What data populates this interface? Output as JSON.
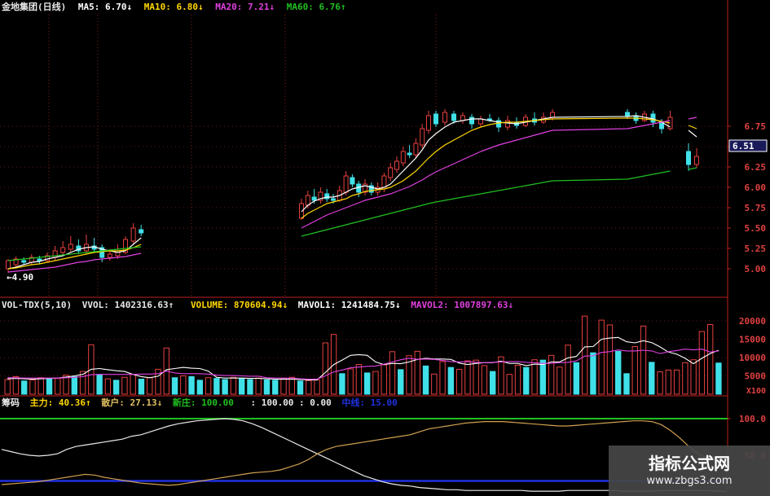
{
  "header_main": {
    "title": "金地集团(日线)",
    "ma5": "MA5: 6.70↓",
    "ma10": "MA10: 6.80↓",
    "ma20": "MA20: 7.21↓",
    "ma60": "MA60: 6.76↑"
  },
  "header_vol": {
    "name": "VOL-TDX(5,10)",
    "vvol": "VVOL: 1402316.63↑",
    "volume": "VOLUME: 870604.94↓",
    "mavol1": "MAVOL1: 1241484.75↓",
    "mavol2": "MAVOL2: 1007897.63↓"
  },
  "header_chip": {
    "name": "筹码",
    "zhuli": "主力: 40.36↑",
    "sanhu": "散户: 27.13↓",
    "xinzhuang": "新庄: 100.00",
    "other": ": 100.00 : 0.00",
    "zhongxian": "中线: 15.00"
  },
  "price_labels": {
    "current": "6.51",
    "low_mark": "4.90"
  },
  "colors": {
    "up": "#e84040",
    "down": "#40e0e8",
    "ma5": "#ffffff",
    "ma10": "#ffd700",
    "ma20": "#e040e0",
    "ma60": "#20c020",
    "axis": "#c02020",
    "ytext": "#e04040"
  },
  "watermark": {
    "title": "指标公式网",
    "url": "www.zbgs3.com"
  },
  "chart_data": [
    {
      "type": "candlestick",
      "title": "金地集团(日线)",
      "y_ticks": [
        5.0,
        5.25,
        5.5,
        5.75,
        6.0,
        6.25,
        6.5,
        6.75
      ],
      "ylim": [
        4.85,
        6.95
      ],
      "current_price": 6.51,
      "low_label": 4.9,
      "candles": [
        [
          5.0,
          5.1,
          4.95,
          5.12
        ],
        [
          5.05,
          5.12,
          5.02,
          5.15
        ],
        [
          5.1,
          5.08,
          5.05,
          5.14
        ],
        [
          5.08,
          5.14,
          5.04,
          5.18
        ],
        [
          5.12,
          5.1,
          5.06,
          5.16
        ],
        [
          5.1,
          5.16,
          5.08,
          5.2
        ],
        [
          5.14,
          5.22,
          5.1,
          5.28
        ],
        [
          5.2,
          5.26,
          5.16,
          5.34
        ],
        [
          5.24,
          5.3,
          5.2,
          5.4
        ],
        [
          5.28,
          5.22,
          5.18,
          5.36
        ],
        [
          5.22,
          5.3,
          5.18,
          5.42
        ],
        [
          5.28,
          5.24,
          5.2,
          5.38
        ],
        [
          5.26,
          5.14,
          5.08,
          5.3
        ],
        [
          5.14,
          5.18,
          5.1,
          5.24
        ],
        [
          5.16,
          5.22,
          5.12,
          5.3
        ],
        [
          5.2,
          5.36,
          5.18,
          5.4
        ],
        [
          5.34,
          5.5,
          5.3,
          5.56
        ],
        [
          5.48,
          5.44,
          5.4,
          5.54
        ],
        [
          5.62,
          5.8,
          5.6,
          5.86
        ],
        [
          5.78,
          5.9,
          5.74,
          5.96
        ],
        [
          5.88,
          5.84,
          5.8,
          5.98
        ],
        [
          5.84,
          5.94,
          5.8,
          6.0
        ],
        [
          5.92,
          5.86,
          5.82,
          5.98
        ],
        [
          5.86,
          5.84,
          5.8,
          5.92
        ],
        [
          5.84,
          5.96,
          5.82,
          6.02
        ],
        [
          5.94,
          6.14,
          5.9,
          6.2
        ],
        [
          6.12,
          6.04,
          6.0,
          6.16
        ],
        [
          6.04,
          5.94,
          5.88,
          6.08
        ],
        [
          5.94,
          6.04,
          5.9,
          6.1
        ],
        [
          6.02,
          5.94,
          5.9,
          6.06
        ],
        [
          5.94,
          6.0,
          5.9,
          6.06
        ],
        [
          5.98,
          6.14,
          5.94,
          6.18
        ],
        [
          6.12,
          6.24,
          6.08,
          6.3
        ],
        [
          6.22,
          6.32,
          6.18,
          6.38
        ],
        [
          6.3,
          6.44,
          6.26,
          6.5
        ],
        [
          6.42,
          6.4,
          6.36,
          6.52
        ],
        [
          6.4,
          6.54,
          6.36,
          6.6
        ],
        [
          6.52,
          6.72,
          6.48,
          6.78
        ],
        [
          6.7,
          6.88,
          6.66,
          6.94
        ],
        [
          6.9,
          6.78,
          6.74,
          6.94
        ],
        [
          6.8,
          6.92,
          6.76,
          6.96
        ],
        [
          6.9,
          6.82,
          6.78,
          6.94
        ],
        [
          6.82,
          6.88,
          6.78,
          6.92
        ],
        [
          6.86,
          6.78,
          6.72,
          6.9
        ],
        [
          6.78,
          6.84,
          6.74,
          6.88
        ],
        [
          6.84,
          6.82,
          6.8,
          6.9
        ],
        [
          6.82,
          6.74,
          6.68,
          6.86
        ],
        [
          6.74,
          6.82,
          6.7,
          6.88
        ],
        [
          6.8,
          6.76,
          6.72,
          6.86
        ],
        [
          6.76,
          6.86,
          6.74,
          6.9
        ],
        [
          6.84,
          6.8,
          6.76,
          6.92
        ],
        [
          6.8,
          6.86,
          6.78,
          6.92
        ],
        [
          6.86,
          6.92,
          6.82,
          6.96
        ],
        [
          6.92,
          6.88,
          6.84,
          6.96
        ],
        [
          6.88,
          6.82,
          6.78,
          6.92
        ],
        [
          6.82,
          6.9,
          6.8,
          6.94
        ],
        [
          6.9,
          6.8,
          6.74,
          6.94
        ],
        [
          6.8,
          6.72,
          6.66,
          6.84
        ],
        [
          6.72,
          6.86,
          6.7,
          6.94
        ],
        [
          6.44,
          6.28,
          6.2,
          6.54
        ],
        [
          6.28,
          6.38,
          6.24,
          6.48
        ]
      ],
      "series": [
        {
          "name": "MA5",
          "values": [
            5.0,
            5.02,
            5.05,
            5.08,
            5.09,
            5.12,
            5.14,
            5.16,
            5.2,
            5.24,
            5.26,
            5.27,
            5.24,
            5.22,
            5.2,
            5.22,
            5.3,
            5.38,
            5.7,
            5.78,
            5.83,
            5.86,
            5.88,
            5.88,
            5.9,
            5.94,
            5.98,
            6.0,
            6.02,
            6.0,
            5.98,
            6.0,
            6.04,
            6.12,
            6.2,
            6.28,
            6.36,
            6.46,
            6.58,
            6.66,
            6.74,
            6.8,
            6.82,
            6.84,
            6.84,
            6.82,
            6.8,
            6.79,
            6.78,
            6.8,
            6.82,
            6.84,
            6.86,
            6.87,
            6.88,
            6.86,
            6.84,
            6.8,
            6.74,
            6.7,
            6.62,
            6.5
          ]
        },
        {
          "name": "MA10",
          "values": [
            5.0,
            5.01,
            5.03,
            5.05,
            5.06,
            5.08,
            5.1,
            5.12,
            5.14,
            5.16,
            5.18,
            5.2,
            5.21,
            5.22,
            5.22,
            5.23,
            5.26,
            5.3,
            5.62,
            5.68,
            5.72,
            5.76,
            5.8,
            5.82,
            5.84,
            5.86,
            5.9,
            5.92,
            5.95,
            5.96,
            5.97,
            5.98,
            6.0,
            6.04,
            6.08,
            6.14,
            6.2,
            6.28,
            6.36,
            6.44,
            6.52,
            6.58,
            6.64,
            6.7,
            6.74,
            6.77,
            6.79,
            6.8,
            6.8,
            6.81,
            6.82,
            6.83,
            6.84,
            6.85,
            6.85,
            6.84,
            6.83,
            6.81,
            6.79,
            6.76,
            6.72,
            6.68
          ]
        },
        {
          "name": "MA20",
          "values": [
            4.96,
            4.97,
            4.98,
            4.99,
            5.0,
            5.01,
            5.02,
            5.04,
            5.06,
            5.08,
            5.09,
            5.11,
            5.12,
            5.13,
            5.14,
            5.15,
            5.17,
            5.19,
            5.5,
            5.54,
            5.58,
            5.62,
            5.66,
            5.69,
            5.72,
            5.75,
            5.78,
            5.81,
            5.84,
            5.86,
            5.88,
            5.9,
            5.92,
            5.95,
            5.98,
            6.01,
            6.05,
            6.09,
            6.14,
            6.19,
            6.24,
            6.29,
            6.34,
            6.39,
            6.44,
            6.48,
            6.52,
            6.55,
            6.58,
            6.61,
            6.64,
            6.67,
            6.7,
            6.72,
            6.74,
            6.76,
            6.78,
            6.8,
            6.82,
            6.84,
            6.86,
            6.88
          ]
        },
        {
          "name": "MA60",
          "values": [
            5.1,
            5.11,
            5.12,
            5.13,
            5.14,
            5.15,
            5.16,
            5.17,
            5.18,
            5.19,
            5.2,
            5.21,
            5.22,
            5.23,
            5.24,
            5.25,
            5.26,
            5.27,
            5.4,
            5.42,
            5.44,
            5.46,
            5.48,
            5.5,
            5.52,
            5.54,
            5.56,
            5.58,
            5.6,
            5.62,
            5.64,
            5.66,
            5.68,
            5.7,
            5.72,
            5.74,
            5.76,
            5.78,
            5.8,
            5.82,
            5.84,
            5.86,
            5.88,
            5.9,
            5.92,
            5.94,
            5.96,
            5.98,
            6.0,
            6.02,
            6.04,
            6.06,
            6.08,
            6.1,
            6.12,
            6.14,
            6.16,
            6.18,
            6.2,
            6.22,
            6.24,
            6.26
          ]
        }
      ]
    },
    {
      "type": "bar",
      "title": "VOL-TDX(5,10)",
      "y_ticks": [
        5000,
        10000,
        15000,
        20000
      ],
      "y_tick_labels": [
        "5000",
        "10000",
        "15000",
        "20000"
      ],
      "unit_label": "X100",
      "ylim": [
        0,
        22000
      ],
      "values": [
        4000,
        4800,
        3600,
        3900,
        4500,
        4200,
        4300,
        5200,
        4800,
        6200,
        13500,
        5400,
        4200,
        3800,
        4600,
        5400,
        4100,
        4500,
        6800,
        12600,
        4500,
        5000,
        4800,
        3800,
        4500,
        4300,
        4000,
        4600,
        4300,
        4000,
        4400,
        3900,
        3800,
        4200,
        4600,
        3600,
        3700,
        3900,
        14000,
        16300,
        5600,
        6900,
        8100,
        5800,
        6200,
        8000,
        11600,
        6700,
        10500,
        11700,
        7700,
        5500,
        8900,
        7300,
        6800,
        9100,
        9300,
        7800,
        6200,
        10200,
        5400,
        7900,
        7300,
        9400,
        9300,
        10600,
        7400,
        13400,
        8600,
        21300,
        11300,
        20200,
        18900,
        11700,
        5600,
        13000,
        18600,
        8700,
        6100,
        6600,
        6600,
        8600,
        9400,
        17100,
        19000,
        8500
      ],
      "series": [
        {
          "name": "MAVOL1",
          "values": [
            4200,
            4300,
            4200,
            4100,
            4200,
            4300,
            4400,
            4700,
            5000,
            5400,
            6800,
            7000,
            6700,
            6400,
            6200,
            5400,
            4800,
            4500,
            4900,
            6700,
            7000,
            7300,
            7100,
            7000,
            6300,
            4600,
            4400,
            4400,
            4400,
            4300,
            4300,
            4200,
            4100,
            4100,
            4100,
            4000,
            3900,
            3900,
            5900,
            8100,
            9300,
            10600,
            10800,
            10600,
            8800,
            8100,
            8400,
            8300,
            8800,
            9500,
            9800,
            9600,
            9600,
            9500,
            8500,
            8100,
            8400,
            8600,
            8600,
            9000,
            8400,
            8400,
            7800,
            8200,
            8100,
            8800,
            8800,
            9900,
            10300,
            12900,
            13000,
            15000,
            15300,
            15500,
            14300,
            14000,
            14600,
            14100,
            12900,
            11500,
            10900,
            9800,
            8300,
            9800,
            11100,
            12000
          ]
        },
        {
          "name": "MAVOL2",
          "values": [
            4500,
            4500,
            4400,
            4400,
            4400,
            4400,
            4400,
            4500,
            4600,
            4800,
            5300,
            5400,
            5400,
            5400,
            5400,
            5400,
            5500,
            5500,
            5600,
            6300,
            5800,
            5600,
            5600,
            5600,
            5500,
            5200,
            5100,
            5100,
            5000,
            4900,
            4900,
            4500,
            4400,
            4400,
            4400,
            4200,
            4100,
            4100,
            5000,
            6100,
            6600,
            7200,
            7400,
            7600,
            7700,
            8200,
            8800,
            9400,
            9800,
            9500,
            9600,
            9500,
            9200,
            8900,
            8800,
            8900,
            8700,
            8600,
            8700,
            8800,
            8900,
            8900,
            8700,
            8600,
            8400,
            8400,
            8600,
            8700,
            9100,
            10400,
            10500,
            11400,
            11600,
            12100,
            11800,
            11800,
            12000,
            11800,
            11100,
            11600,
            11900,
            12300,
            12100,
            12300,
            11500,
            11800
          ]
        }
      ]
    },
    {
      "type": "line",
      "title": "筹码",
      "y_ticks": [
        50,
        100
      ],
      "y_tick_labels": [
        "50.0",
        "100.0"
      ],
      "ylim": [
        0,
        110
      ],
      "series": [
        {
          "name": "主力",
          "values": [
            58,
            55,
            52,
            50,
            49,
            50,
            52,
            58,
            62,
            64,
            66,
            68,
            70,
            72,
            76,
            78,
            82,
            86,
            90,
            93,
            95,
            97,
            98,
            99,
            100,
            99,
            97,
            93,
            88,
            82,
            76,
            70,
            64,
            58,
            52,
            46,
            40,
            34,
            28,
            22,
            18,
            14,
            11,
            9,
            8,
            6,
            5,
            4,
            3,
            3,
            2,
            2,
            2,
            2,
            2,
            2,
            2,
            1,
            1,
            1,
            1,
            2,
            2,
            2,
            2,
            2,
            2,
            1,
            1,
            1,
            1,
            2,
            2,
            2,
            2,
            2,
            2,
            1,
            1
          ]
        },
        {
          "name": "散户",
          "values": [
            10,
            11,
            12,
            13,
            14,
            16,
            18,
            20,
            22,
            24,
            23,
            20,
            18,
            16,
            14,
            12,
            11,
            10,
            9,
            10,
            12,
            14,
            16,
            18,
            20,
            22,
            24,
            26,
            27,
            28,
            30,
            34,
            38,
            44,
            52,
            58,
            62,
            64,
            66,
            68,
            70,
            72,
            74,
            76,
            78,
            82,
            86,
            88,
            90,
            92,
            94,
            95,
            96,
            96,
            96,
            95,
            94,
            93,
            92,
            91,
            90,
            90,
            91,
            92,
            93,
            94,
            95,
            96,
            97,
            97,
            96,
            92,
            84,
            74,
            62,
            52,
            46,
            42,
            40
          ]
        }
      ]
    }
  ]
}
